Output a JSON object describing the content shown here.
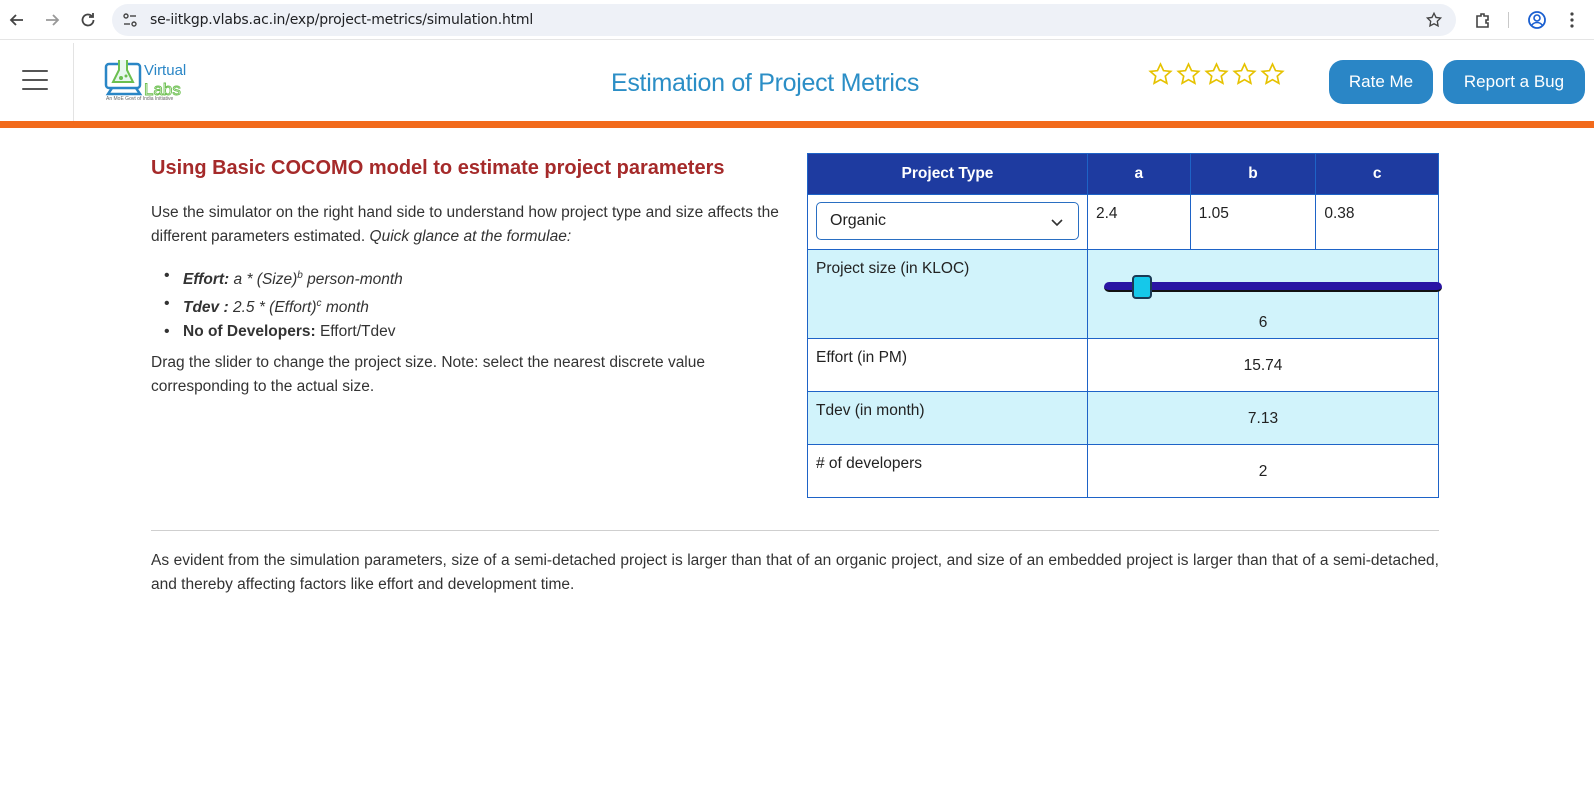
{
  "browser": {
    "url": "se-iitkgp.vlabs.ac.in/exp/project-metrics/simulation.html"
  },
  "header": {
    "logo_text_top": "Virtual",
    "logo_text_bottom": "Labs",
    "logo_tagline": "An MoE Govt of India Initiative",
    "title": "Estimation of Project Metrics",
    "rating_stars": 5,
    "rate_label": "Rate Me",
    "bug_label": "Report a Bug"
  },
  "content": {
    "title": "Using Basic COCOMO model to estimate project parameters",
    "intro_plain": "Use the simulator on the right hand side to understand how project type and size affects the different parameters estimated. ",
    "intro_italic": "Quick glance at the formulae:",
    "formulas": {
      "effort_label": "Effort:",
      "effort_expr": " a * (Size)",
      "effort_sup": "b",
      "effort_unit": " person-month",
      "tdev_label": "Tdev :",
      "tdev_expr": " 2.5 * (Effort)",
      "tdev_sup": "c",
      "tdev_unit": " month",
      "devs_label": "No of Developers:",
      "devs_expr": " Effort/Tdev"
    },
    "drag_note": "Drag the slider to change the project size. Note: select the nearest discrete value corresponding to the actual size."
  },
  "table": {
    "headers": [
      "Project Type",
      "a",
      "b",
      "c"
    ],
    "project_type": "Organic",
    "a": "2.4",
    "b": "1.05",
    "c": "0.38",
    "size_label": "Project size (in KLOC)",
    "size_value": "6",
    "effort_label": "Effort (in PM)",
    "effort_value": "15.74",
    "tdev_label": "Tdev (in month)",
    "tdev_value": "7.13",
    "devs_label": "# of developers",
    "devs_value": "2"
  },
  "footer": {
    "text": "As evident from the simulation parameters, size of a semi-detached project is larger than that of an organic project, and size of an embedded project is larger than that of a semi-detached, and thereby affecting factors like effort and development time."
  },
  "colors": {
    "brand_blue": "#2a86c6",
    "accent_orange": "#f26a1b",
    "heading_red": "#a52a2a",
    "table_header": "#1e3ba0",
    "row_light": "#d1f3fb",
    "slider_track": "#2a15a4",
    "slider_thumb": "#15c8ea"
  },
  "icons": [
    "back-arrow-icon",
    "forward-arrow-icon",
    "reload-icon",
    "site-info-icon",
    "bookmark-star-icon",
    "extensions-icon",
    "profile-icon",
    "kebab-menu-icon",
    "hamburger-icon",
    "chevron-down-icon",
    "rating-star-icon"
  ]
}
